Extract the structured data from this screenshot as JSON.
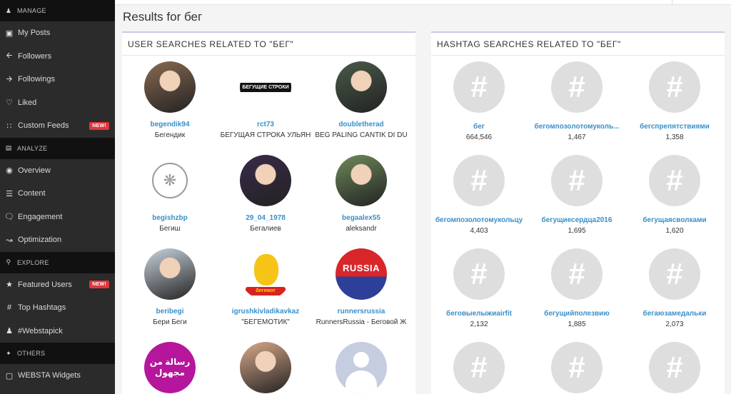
{
  "sidebar": {
    "sections": [
      {
        "title": "MANAGE",
        "icon": "user-icon",
        "items": [
          {
            "label": "My Posts",
            "icon": "camera-icon"
          },
          {
            "label": "Followers",
            "icon": "arrow-left-icon"
          },
          {
            "label": "Followings",
            "icon": "arrow-right-icon"
          },
          {
            "label": "Liked",
            "icon": "heart-icon"
          },
          {
            "label": "Custom Feeds",
            "icon": "grid-icon",
            "badge": "NEW!"
          }
        ]
      },
      {
        "title": "ANALYZE",
        "icon": "chart-area-icon",
        "items": [
          {
            "label": "Overview",
            "icon": "dashboard-icon"
          },
          {
            "label": "Content",
            "icon": "list-icon"
          },
          {
            "label": "Engagement",
            "icon": "comments-icon"
          },
          {
            "label": "Optimization",
            "icon": "line-chart-icon"
          }
        ]
      },
      {
        "title": "EXPLORE",
        "icon": "search-icon",
        "items": [
          {
            "label": "Featured Users",
            "icon": "trophy-icon",
            "badge": "NEW!"
          },
          {
            "label": "Top Hashtags",
            "icon": "hashtag-icon"
          },
          {
            "label": "#Webstapick",
            "icon": "user-small-icon"
          }
        ]
      },
      {
        "title": "OTHERS",
        "icon": "magic-wand-icon",
        "items": [
          {
            "label": "WEBSTA Widgets",
            "icon": "window-icon"
          }
        ]
      }
    ]
  },
  "main": {
    "results_prefix": "Results for ",
    "query": "бег",
    "user_panel_title": "USER SEARCHES RELATED TO \"БЕГ\"",
    "hashtag_panel_title": "HASHTAG SEARCHES RELATED TO \"БЕГ\""
  },
  "users": [
    {
      "username": "begendik94",
      "fullname": "Бегендик",
      "avatar_color": "#8a6a52"
    },
    {
      "username": "rct73",
      "fullname": "БЕГУЩАЯ СТРОКА УЛЬЯН",
      "avatar_text": "БЕГУЩИЕ СТРОКИ"
    },
    {
      "username": "doubletherad",
      "fullname": "BEG PALING CANTIK DI DU",
      "avatar_color": "#4a5a4a"
    },
    {
      "username": "begishzbp",
      "fullname": "Бегиш",
      "avatar_color": "#f2f2f2"
    },
    {
      "username": "29_04_1978",
      "fullname": "Бегалиев",
      "avatar_color": "#3a2a4a"
    },
    {
      "username": "begaalex55",
      "fullname": "aleksandr",
      "avatar_color": "#6e8a5a"
    },
    {
      "username": "beribegi",
      "fullname": "Бери Беги",
      "avatar_color": "#c9d4de"
    },
    {
      "username": "igrushkivladikavkaz",
      "fullname": "\"БЕГЕМОТИК\"",
      "avatar_text": "бегемот"
    },
    {
      "username": "runnersrussia",
      "fullname": "RunnersRussia - Беговой Ж",
      "avatar_text": "RUSSIA"
    },
    {
      "username": "",
      "fullname": "",
      "avatar_text": "رسالة من مجهول"
    },
    {
      "username": "",
      "fullname": "",
      "avatar_color": "#d8a98a"
    },
    {
      "username": "",
      "fullname": "",
      "avatar_color": "#c6cde0"
    }
  ],
  "hashtags": [
    {
      "name": "бег",
      "count": "664,546"
    },
    {
      "name": "бегомпозолотомуколь...",
      "count": "1,467"
    },
    {
      "name": "бегспрепятствиями",
      "count": "1,358"
    },
    {
      "name": "бегомпозолотомукольцу",
      "count": "4,403"
    },
    {
      "name": "бегущиесердца2016",
      "count": "1,695"
    },
    {
      "name": "бегущаясволками",
      "count": "1,620"
    },
    {
      "name": "беговыелыжиairfit",
      "count": "2,132"
    },
    {
      "name": "бегущийполезвию",
      "count": "1,885"
    },
    {
      "name": "бегаюзамедальки",
      "count": "2,073"
    },
    {
      "name": "",
      "count": ""
    },
    {
      "name": "",
      "count": ""
    },
    {
      "name": "",
      "count": ""
    }
  ],
  "hash_symbol": "#",
  "colors": {
    "sidebar_bg": "#2b2b2b",
    "section_bg": "#111111",
    "link": "#3a8fc9",
    "badge": "#e0353a"
  }
}
